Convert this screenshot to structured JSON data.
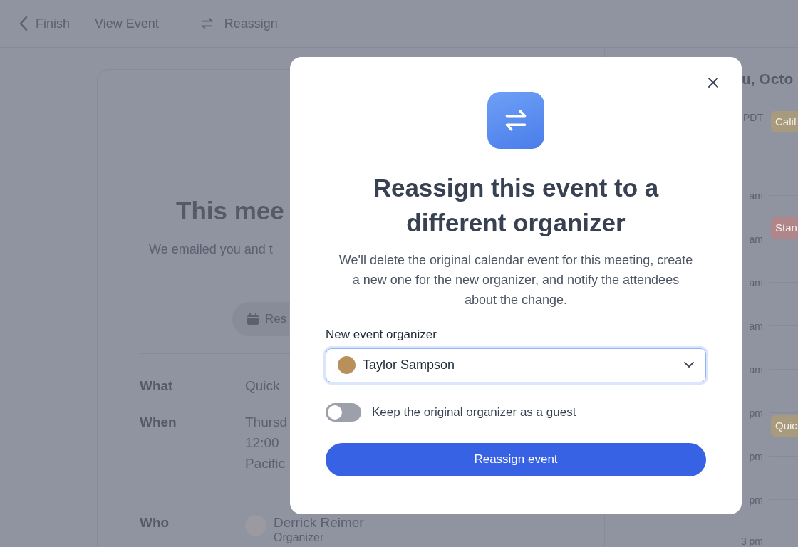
{
  "top_nav": {
    "back": "Finish",
    "view": "View Event",
    "reassign": "Reassign"
  },
  "event_card": {
    "heading": "This mee",
    "subtitle": "We emailed you and t",
    "button": "Res",
    "rows": [
      {
        "kind": "text",
        "label": "What",
        "lines": [
          "Quick"
        ]
      },
      {
        "kind": "text",
        "label": "When",
        "lines": [
          "Thursd",
          "12:00",
          "Pacific"
        ]
      },
      {
        "kind": "person",
        "label": "Who",
        "lines": [
          "Derrick Reimer",
          "Organizer"
        ]
      }
    ]
  },
  "calendar": {
    "date": "u, Octo",
    "rows": [
      {
        "label": "PDT",
        "events": [
          {
            "title": "Calif",
            "color": "#a89a7c"
          }
        ]
      },
      {
        "label": "am",
        "events": []
      },
      {
        "label": "am",
        "events": [
          {
            "title": "Stan",
            "color": "#b0868a"
          }
        ]
      },
      {
        "label": "am",
        "events": []
      },
      {
        "label": "am",
        "events": []
      },
      {
        "label": "am",
        "events": []
      },
      {
        "label": "pm",
        "events": []
      },
      {
        "label": "pm",
        "events": [
          {
            "title": "Quic",
            "color": "#a89a7c"
          }
        ]
      },
      {
        "label": "pm",
        "events": []
      },
      {
        "label": "3 pm",
        "events": []
      }
    ]
  },
  "modal": {
    "title": "Reassign this event to a different organizer",
    "description": "We'll delete the original calendar event for this meeting, create a new one for the new organizer, and notify the attendees about the change.",
    "field": {
      "label": "New event organizer",
      "value": "Taylor Sampson"
    },
    "toggle": {
      "label": "Keep the original organizer as a guest",
      "on": false
    },
    "submit": "Reassign event"
  }
}
